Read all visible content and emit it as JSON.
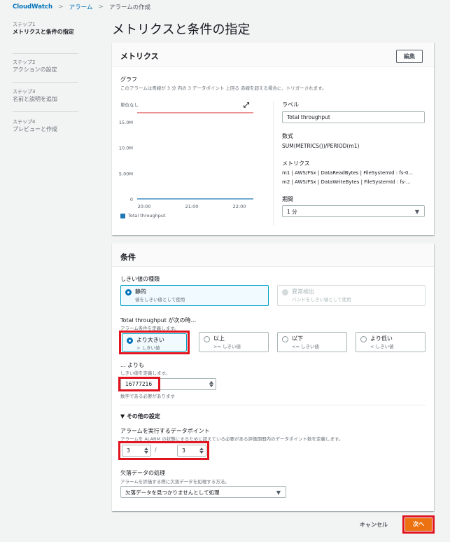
{
  "breadcrumb": {
    "items": [
      "CloudWatch",
      "アラーム",
      "アラームの作成"
    ],
    "sep": ">"
  },
  "steps": [
    {
      "num": "ステップ1",
      "title": "メトリクスと条件の指定"
    },
    {
      "num": "ステップ2",
      "title": "アクションの設定"
    },
    {
      "num": "ステップ3",
      "title": "名前と説明を追加"
    },
    {
      "num": "ステップ4",
      "title": "プレビューと作成"
    }
  ],
  "page_title": "メトリクスと条件の指定",
  "metrics": {
    "title": "メトリクス",
    "edit_label": "編集",
    "graph_label": "グラフ",
    "graph_desc": "このアラームは青線が 3 分 内の 3 データポイント 上回る 赤線を超える場合に、トリガーされます。",
    "unit_label": "単位なし",
    "expand_icon": "expand-icon",
    "legend": "Total throughput",
    "label_title": "ラベル",
    "label_value": "Total throughput",
    "formula_title": "数式",
    "formula_value": "SUM(METRICS())/PERIOD(m1)",
    "metrics_title": "メトリクス",
    "metric_m1": "m1 | AWS/FSx | DataReadBytes | FileSystemId : fs-0...",
    "metric_m2": "m2 | AWS/FSx | DataWriteBytes | FileSystemId : fs-...",
    "period_title": "期間",
    "period_value": "1 分"
  },
  "chart_data": {
    "type": "line",
    "x": [
      "20:00",
      "21:00",
      "22:00"
    ],
    "ylim": [
      0,
      16777216
    ],
    "yticks": [
      "15.0M",
      "10.0M",
      "5.00M",
      "0"
    ],
    "ytick_values": [
      15000000,
      10000000,
      5000000,
      0
    ],
    "series": [
      {
        "name": "Total throughput",
        "values": [
          0,
          0,
          0
        ],
        "color": "#1f77b4"
      }
    ],
    "threshold": 16777216,
    "threshold_color": "#d62728",
    "grid": false,
    "legend_position": "bottom-left"
  },
  "conditions": {
    "title": "条件",
    "threshold_type_label": "しきい値の種類",
    "static_title": "静的",
    "static_desc": "値をしきい値として使用",
    "anomaly_title": "異常検出",
    "anomaly_desc": "バンドをしきい値として使用",
    "when_label": "Total throughput が次の時...",
    "when_desc": "アラーム条件を定義します。",
    "options": [
      {
        "title": "より大きい",
        "desc": "> しきい値"
      },
      {
        "title": "以上",
        "desc": ">= しきい値"
      },
      {
        "title": "以下",
        "desc": "<= しきい値"
      },
      {
        "title": "より低い",
        "desc": "< しきい値"
      }
    ],
    "than_label": "... よりも",
    "than_desc": "しきい値を定義します。",
    "threshold_value": "16777216",
    "than_hint": "数字である必要があります"
  },
  "additional": {
    "title": "その他の設定",
    "datapoints_label": "アラームを実行するデータポイント",
    "datapoints_desc": "アラームを ALARM の状態にするために超えている必要がある評価期間内のデータポイント数を定義します。",
    "datapoints_a": "3",
    "datapoints_sep": "/",
    "datapoints_b": "3",
    "missing_label": "欠落データの処理",
    "missing_desc": "アラームを評価する際に欠落データを処理する方法。",
    "missing_value": "欠落データを見つかりませんとして処理"
  },
  "footer": {
    "cancel": "キャンセル",
    "next": "次へ"
  }
}
